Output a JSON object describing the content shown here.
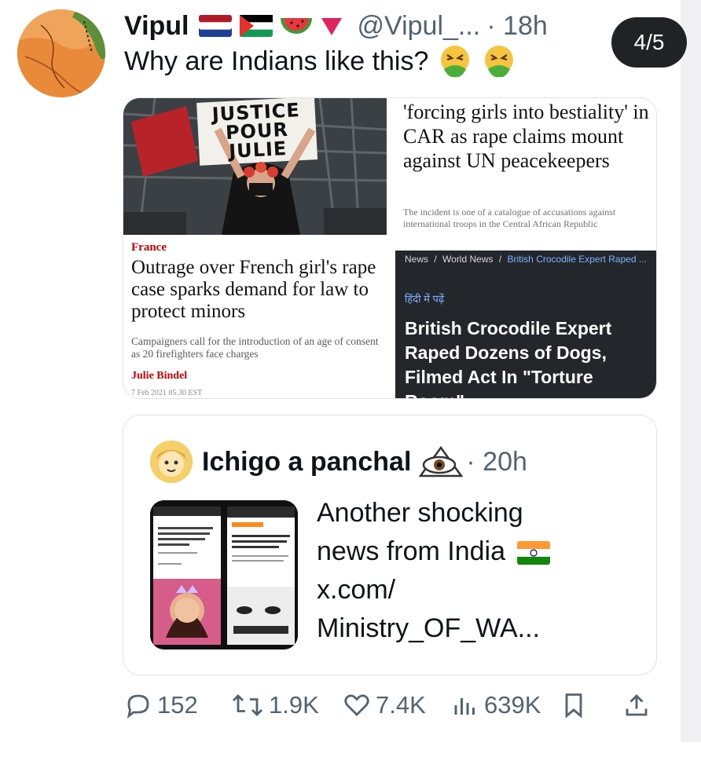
{
  "tweet": {
    "author_name": "Vipul",
    "handle": "@Vipul_...",
    "time": "· 18h",
    "text": "Why are Indians like this?",
    "media_counter": "4/5"
  },
  "articles": {
    "left": {
      "photo_sign_text": "JUSTICE POUR JULIE",
      "section": "France",
      "headline": "Outrage over French girl's rape case sparks demand for law to protect minors",
      "standfirst": "Campaigners call for the introduction of an age of consent as 20 firefighters face charges",
      "byline": "Julie Bindel",
      "date": "7 Feb 2021 05.30 EST"
    },
    "right_top": {
      "headline": "'forcing girls into bestiality' in CAR as rape claims mount against UN peacekeepers",
      "standfirst": "The incident is one of a catalogue of accusations against international troops in the Central African Republic"
    },
    "right_dark": {
      "crumb_1": "News",
      "crumb_2": "World News",
      "crumb_3": "British Crocodile Expert Raped ...",
      "hindi_link": "हिंदी में पढ़ें",
      "headline": "British Crocodile Expert Raped Dozens of Dogs, Filmed Act In \"Torture Room\""
    }
  },
  "quote": {
    "author_name": "Ichigo a panchal",
    "time": "· 20h",
    "text_line1": "Another shocking",
    "text_line2": "news from India",
    "text_line3": "x.com/",
    "text_line4": "Ministry_OF_WA..."
  },
  "actions": {
    "replies": "152",
    "reposts": "1.9K",
    "likes": "7.4K",
    "views": "639K"
  },
  "colors": {
    "accent_red": "#c70000",
    "dark_panel": "#23262a",
    "muted_text": "#536471"
  },
  "icons": [
    "reply-icon",
    "repost-icon",
    "like-icon",
    "views-icon",
    "bookmark-icon",
    "share-icon"
  ]
}
